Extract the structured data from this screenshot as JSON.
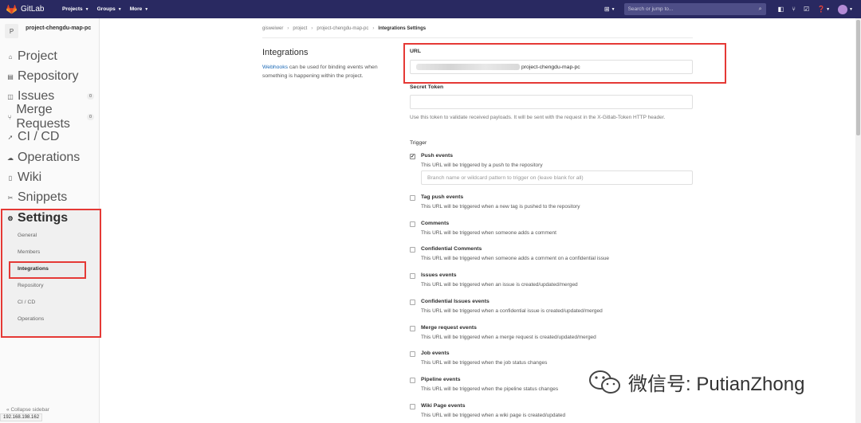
{
  "topbar": {
    "brand": "GitLab",
    "nav": [
      {
        "label": "Projects"
      },
      {
        "label": "Groups"
      },
      {
        "label": "More"
      }
    ],
    "search_placeholder": "Search or jump to..."
  },
  "sidebar": {
    "project_initial": "P",
    "project_name": "project-chengdu-map-pc",
    "items": [
      {
        "label": "Project",
        "icon": "home-icon"
      },
      {
        "label": "Repository",
        "icon": "book-icon"
      },
      {
        "label": "Issues",
        "icon": "issues-icon",
        "count": "0"
      },
      {
        "label": "Merge Requests",
        "icon": "merge-icon",
        "count": "0"
      },
      {
        "label": "CI / CD",
        "icon": "rocket-icon"
      },
      {
        "label": "Operations",
        "icon": "cloud-icon"
      },
      {
        "label": "Wiki",
        "icon": "wiki-icon"
      },
      {
        "label": "Snippets",
        "icon": "scissors-icon"
      },
      {
        "label": "Settings",
        "icon": "gear-icon"
      }
    ],
    "settings_sub": [
      "General",
      "Members",
      "Integrations",
      "Repository",
      "CI / CD",
      "Operations"
    ],
    "collapse_label": "Collapse sidebar",
    "status_url": "192.168.198.162"
  },
  "breadcrumb": [
    "gisweiwer",
    "project",
    "project-chengdu-map-pc",
    "Integrations Settings"
  ],
  "integrations": {
    "title": "Integrations",
    "desc_link": "Webhooks",
    "desc_rest": " can be used for binding events when something is happening within the project."
  },
  "form": {
    "url_label": "URL",
    "url_value": "project-chengdu-map-pc",
    "secret_label": "Secret Token",
    "secret_hint": "Use this token to validate received payloads. It will be sent with the request in the X-Gitlab-Token HTTP header.",
    "trigger_label": "Trigger",
    "branch_placeholder": "Branch name or wildcard pattern to trigger on (leave blank for all)",
    "events": [
      {
        "title": "Push events",
        "desc": "This URL will be triggered by a push to the repository",
        "checked": true
      },
      {
        "title": "Tag push events",
        "desc": "This URL will be triggered when a new tag is pushed to the repository",
        "checked": false
      },
      {
        "title": "Comments",
        "desc": "This URL will be triggered when someone adds a comment",
        "checked": false
      },
      {
        "title": "Confidential Comments",
        "desc": "This URL will be triggered when someone adds a comment on a confidential issue",
        "checked": false
      },
      {
        "title": "Issues events",
        "desc": "This URL will be triggered when an issue is created/updated/merged",
        "checked": false
      },
      {
        "title": "Confidential Issues events",
        "desc": "This URL will be triggered when a confidential issue is created/updated/merged",
        "checked": false
      },
      {
        "title": "Merge request events",
        "desc": "This URL will be triggered when a merge request is created/updated/merged",
        "checked": false
      },
      {
        "title": "Job events",
        "desc": "This URL will be triggered when the job status changes",
        "checked": false
      },
      {
        "title": "Pipeline events",
        "desc": "This URL will be triggered when the pipeline status changes",
        "checked": false
      },
      {
        "title": "Wiki Page events",
        "desc": "This URL will be triggered when a wiki page is created/updated",
        "checked": false
      }
    ]
  },
  "watermark": "微信号: PutianZhong"
}
